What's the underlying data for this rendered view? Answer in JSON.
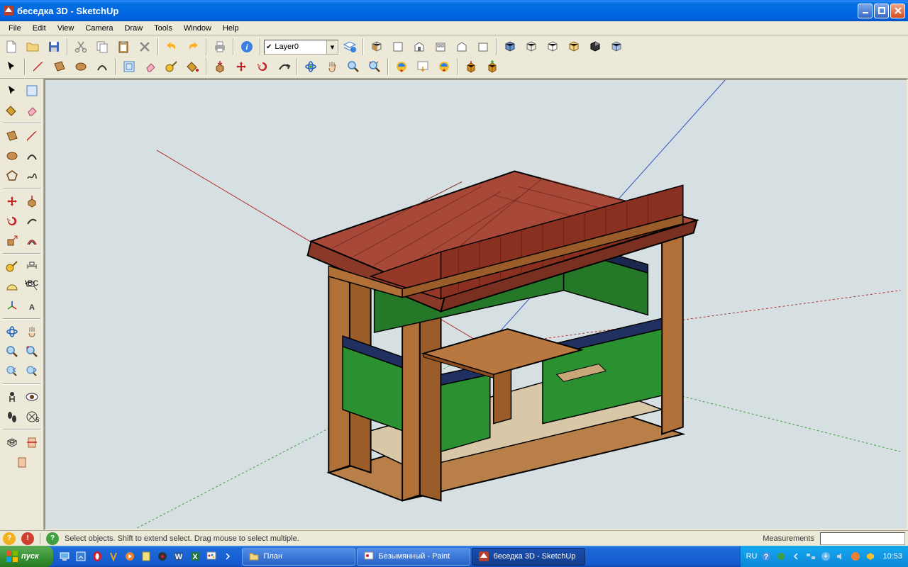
{
  "window": {
    "title": "беседка 3D - SketchUp"
  },
  "menu": [
    "File",
    "Edit",
    "View",
    "Camera",
    "Draw",
    "Tools",
    "Window",
    "Help"
  ],
  "layer": {
    "selected": "Layer0"
  },
  "status": {
    "hint": "Select objects. Shift to extend select. Drag mouse to select multiple.",
    "measurements_label": "Measurements"
  },
  "taskbar": {
    "start": "пуск",
    "items": [
      {
        "label": "План",
        "active": false
      },
      {
        "label": "Безымянный - Paint",
        "active": false
      },
      {
        "label": "беседка 3D - SketchUp",
        "active": true
      }
    ],
    "lang": "RU",
    "time": "10:53"
  }
}
